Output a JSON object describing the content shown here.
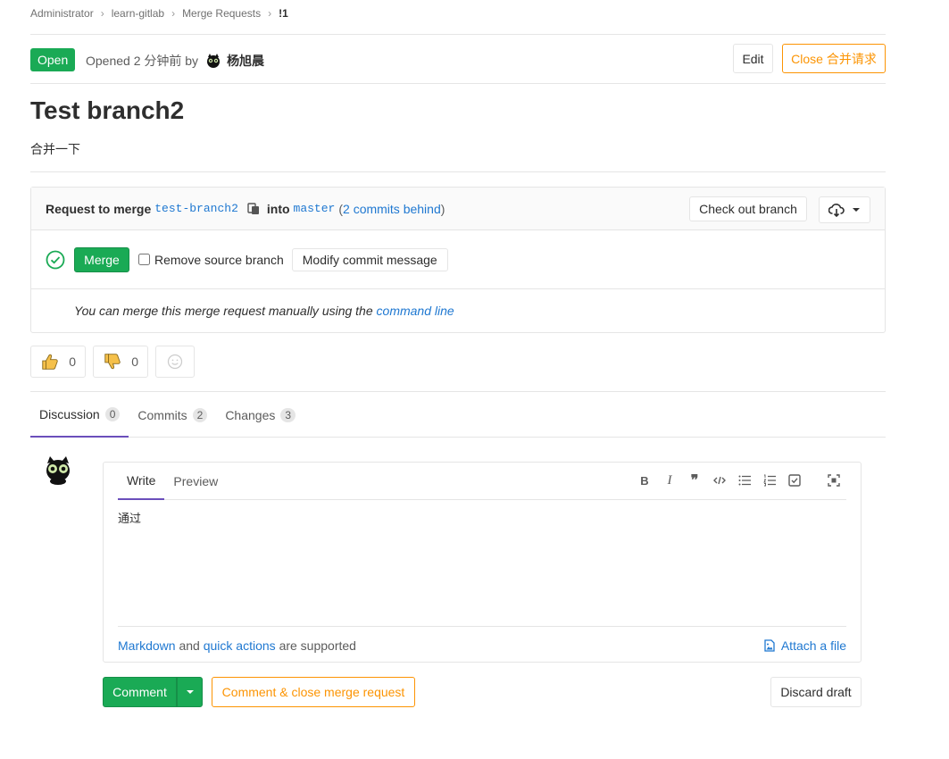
{
  "breadcrumb": {
    "items": [
      "Administrator",
      "learn-gitlab",
      "Merge Requests",
      "!1"
    ]
  },
  "status": {
    "badge": "Open",
    "opened_prefix": "Opened 2 分钟前 by",
    "author": "杨旭晨"
  },
  "header_actions": {
    "edit": "Edit",
    "close": "Close 合并请求"
  },
  "mr": {
    "title": "Test branch2",
    "description": "合并一下"
  },
  "widget": {
    "request_label": "Request to merge",
    "source_branch": "test-branch2",
    "into_label": "into",
    "target_branch": "master",
    "behind_open": "(",
    "behind_link": "2 commits behind",
    "behind_close": ")",
    "checkout_label": "Check out branch",
    "merge_label": "Merge",
    "remove_source_label": "Remove source branch",
    "remove_source_checked": false,
    "modify_commit_label": "Modify commit message",
    "manual_text": "You can merge this merge request manually using the",
    "manual_link": "command line"
  },
  "awards": {
    "thumbs_up": "0",
    "thumbs_down": "0"
  },
  "tabs": [
    {
      "label": "Discussion",
      "count": "0"
    },
    {
      "label": "Commits",
      "count": "2"
    },
    {
      "label": "Changes",
      "count": "3"
    }
  ],
  "editor": {
    "write_tab": "Write",
    "preview_tab": "Preview",
    "content": "通过",
    "toolbar_icons": [
      "bold-icon",
      "italic-icon",
      "quote-icon",
      "code-icon",
      "bullet-list-icon",
      "numbered-list-icon",
      "task-list-icon",
      "fullscreen-icon"
    ],
    "footer_markdown": "Markdown",
    "footer_and": "and",
    "footer_quick_actions": "quick actions",
    "footer_supported": "are supported",
    "attach_label": "Attach a file"
  },
  "actions": {
    "comment": "Comment",
    "comment_close": "Comment & close merge request",
    "discard": "Discard draft"
  },
  "colors": {
    "success": "#1aaa55",
    "warning": "#fc9403",
    "link": "#1f78d1",
    "active_tab": "#6b4fbb"
  }
}
